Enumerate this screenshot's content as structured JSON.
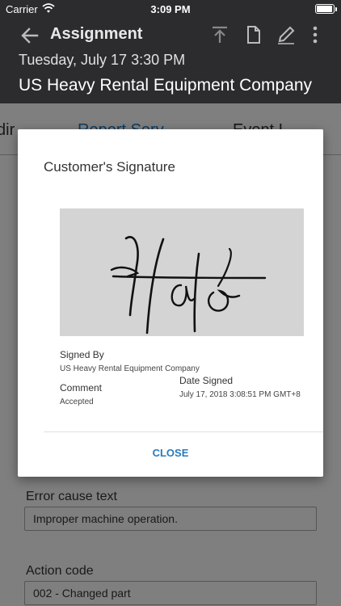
{
  "status_bar": {
    "carrier": "Carrier",
    "time": "3:09 PM",
    "battery_level": 0.95
  },
  "app_bar": {
    "title": "Assignment",
    "date": "Tuesday, July 17 3:30 PM",
    "company": "US Heavy Rental Equipment Company",
    "icons": [
      "back-arrow-icon",
      "upload-icon",
      "document-icon",
      "edit-pencil-icon",
      "more-vert-icon"
    ]
  },
  "tabs": [
    "dir",
    "Report Serv",
    "Event L"
  ],
  "form": {
    "error_cause_label": "Error cause text",
    "error_cause_value": "Improper machine operation.",
    "action_code_label": "Action code",
    "action_code_value": "002 - Changed part"
  },
  "dialog": {
    "title": "Customer's Signature",
    "signature_text": "Hafo",
    "signed_by_label": "Signed By",
    "signed_by_value": "US Heavy Rental Equipment Company",
    "comment_label": "Comment",
    "comment_value": "Accepted",
    "date_signed_label": "Date Signed",
    "date_signed_value": "July 17, 2018 3:08:51 PM GMT+8",
    "close_label": "CLOSE"
  },
  "colors": {
    "app_bar": "#2c2c2e",
    "accent": "#2a79bd",
    "signature_bg": "#d4d4d4"
  }
}
